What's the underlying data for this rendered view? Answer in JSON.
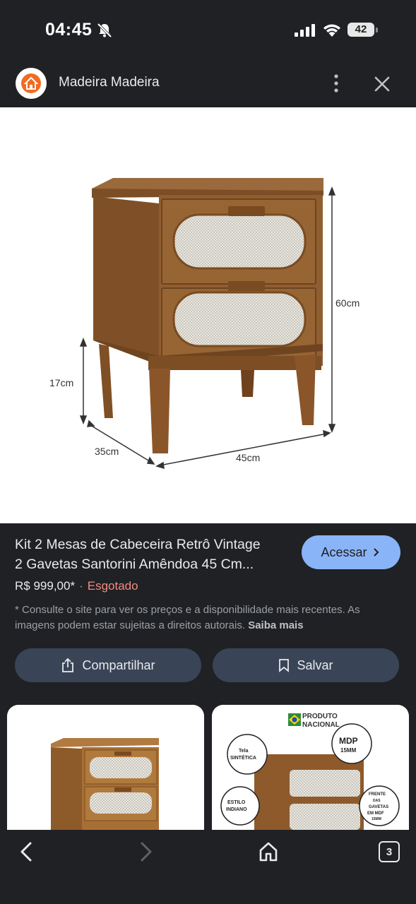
{
  "status_bar": {
    "time": "04:45",
    "battery": "42",
    "icons": [
      "bell-off-icon",
      "signal-icon",
      "wifi-icon",
      "battery-icon"
    ]
  },
  "header": {
    "site_name": "Madeira Madeira",
    "logo_icon": "house-logo-icon",
    "more_icon": "more-vert-icon",
    "close_icon": "close-icon"
  },
  "image": {
    "dimensions": {
      "height": "60cm",
      "leg_height": "17cm",
      "depth": "35cm",
      "width": "45cm"
    }
  },
  "product": {
    "title_line1": "Kit 2 Mesas de Cabeceira Retrô Vintage",
    "title_line2": "2 Gavetas Santorini Amêndoa 45 Cm...",
    "price": "R$ 999,00*",
    "separator": "·",
    "availability": "Esgotado",
    "disclaimer": "* Consulte o site para ver os preços e a disponibilidade mais recentes. As imagens podem estar sujeitas a direitos autorais.",
    "learn_more": "Saiba mais"
  },
  "actions": {
    "access_label": "Acessar",
    "share_label": "Compartilhar",
    "save_label": "Salvar"
  },
  "related": {
    "badge_line1": "PRODUTO",
    "badge_line2": "NACIONAL",
    "callouts": [
      "Tela SINTÉTICA",
      "MDP 15MM",
      "ESTILO INDIANO",
      "FRENTE DAS GAVETAS EM MDF 15MM"
    ]
  },
  "nav": {
    "tab_count": "3"
  },
  "colors": {
    "background": "#202124",
    "accent": "#8ab4f8",
    "button": "#394457",
    "sold_out": "#f28b82",
    "wood": "#8b5a2b"
  }
}
